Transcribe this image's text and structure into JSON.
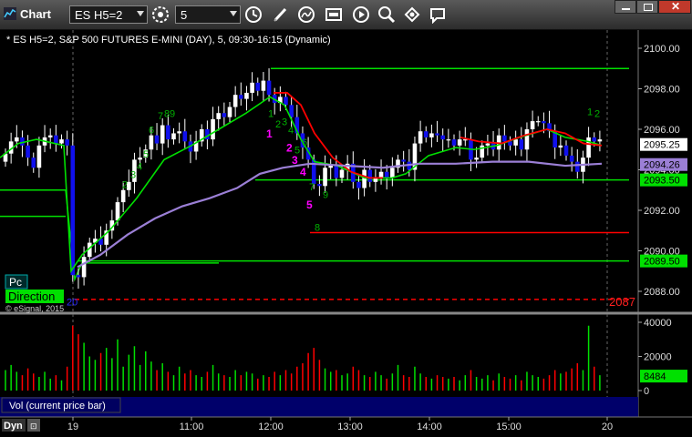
{
  "window": {
    "title": "Chart",
    "symbol": "ES H5=2",
    "interval": "5"
  },
  "chart": {
    "header": "* ES H5=2, S&P 500 FUTURES E-MINI (DAY), 5, 09:30-16:15 (Dynamic)",
    "price_ticks": [
      "2100.00",
      "2098.00",
      "2096.00",
      "2094.00",
      "2092.00",
      "2090.00",
      "2088.00"
    ],
    "price_badges": [
      {
        "label": "2095.25",
        "bg": "#ffffff",
        "fg": "#000000"
      },
      {
        "label": "2094.26",
        "bg": "#9b7fd6",
        "fg": "#000000"
      },
      {
        "label": "2093.50",
        "bg": "#00e000",
        "fg": "#000000"
      },
      {
        "label": "2089.50",
        "bg": "#00e000",
        "fg": "#000000"
      }
    ],
    "red_level_label": "2087",
    "pc_label": "Pc",
    "direction_label": "Direction",
    "copyright": "© eSignal, 2015",
    "counts_green": [
      "2",
      "3",
      "4",
      "5",
      "6",
      "7",
      "8",
      "9",
      "1",
      "2",
      "3",
      "4",
      "5",
      "6",
      "7",
      "9",
      "8",
      "1",
      "2"
    ],
    "counts_magenta": [
      "1",
      "2",
      "3",
      "4",
      "5"
    ],
    "counts_blue": [
      "20"
    ]
  },
  "volume": {
    "label": "Vol (current price bar)",
    "ticks": [
      "40000",
      "20000",
      "0"
    ],
    "current_badge": "8484"
  },
  "time_axis": {
    "mode_label": "Dyn",
    "ticks": [
      "19",
      "11:00",
      "12:00",
      "13:00",
      "14:00",
      "15:00",
      "20"
    ]
  },
  "colors": {
    "up": "#ffffff",
    "down": "#1010ee",
    "green": "#00e000",
    "red": "#ff0000",
    "purple": "#9b7fd6",
    "magenta": "#ff00ff"
  }
}
